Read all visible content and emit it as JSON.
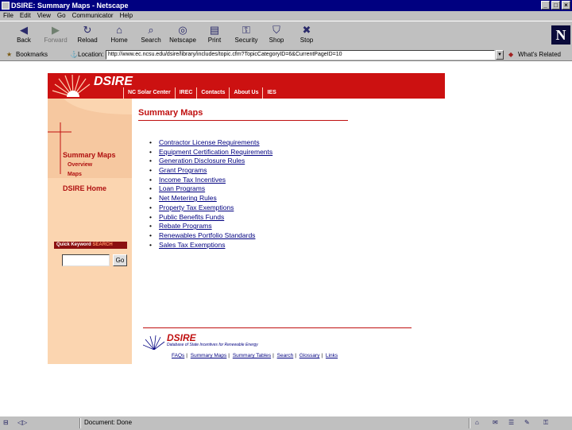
{
  "window": {
    "title": "DSIRE: Summary Maps - Netscape",
    "btn_min": "_",
    "btn_max": "□",
    "btn_close": "×"
  },
  "menus": [
    "File",
    "Edit",
    "View",
    "Go",
    "Communicator",
    "Help"
  ],
  "toolbar": {
    "buttons": [
      {
        "label": "Back",
        "icon": "back-arrow-icon",
        "glyph": "◀"
      },
      {
        "label": "Forward",
        "icon": "forward-arrow-icon",
        "glyph": "▶"
      },
      {
        "label": "Reload",
        "icon": "reload-icon",
        "glyph": "↻"
      },
      {
        "label": "Home",
        "icon": "home-icon",
        "glyph": "⌂"
      },
      {
        "label": "Search",
        "icon": "search-icon",
        "glyph": "⌕"
      },
      {
        "label": "Netscape",
        "icon": "netscape-icon",
        "glyph": "◎"
      },
      {
        "label": "Print",
        "icon": "print-icon",
        "glyph": "▤"
      },
      {
        "label": "Security",
        "icon": "lock-icon",
        "glyph": "⚿"
      },
      {
        "label": "Shop",
        "icon": "shop-icon",
        "glyph": "⛉"
      },
      {
        "label": "Stop",
        "icon": "stop-icon",
        "glyph": "✖"
      }
    ],
    "logo": "N"
  },
  "location": {
    "bookmarks": "Bookmarks",
    "location_label": "Location:",
    "url": "http://www.ec.ncsu.edu/dsire/library/includes/topic.cfm?TopicCategoryID=6&CurrentPageID=10",
    "related": "What's Related"
  },
  "site": {
    "brand": "DSIRE",
    "nav": [
      "NC Solar Center",
      "IREC",
      "Contacts",
      "About Us",
      "IES"
    ],
    "sidebar": {
      "summary_maps": "Summary Maps",
      "overview": "Overview",
      "maps": "Maps",
      "home": "DSIRE Home",
      "keyword_label": "Quick Keyword",
      "keyword_highlight": "SEARCH",
      "go": "Go"
    },
    "content": {
      "title": "Summary Maps",
      "items": [
        "Contractor License Requirements",
        "Equipment Certification Requirements",
        "Generation Disclosure Rules",
        "Grant Programs",
        "Income Tax Incentives",
        "Loan Programs",
        "Net Metering Rules",
        "Property Tax Exemptions",
        "Public Benefits Funds",
        "Rebate Programs",
        "Renewables Portfolio Standards",
        "Sales Tax Exemptions"
      ]
    },
    "footer": {
      "brand": "DSIRE",
      "tagline": "Database of State Incentives for Renewable Energy",
      "links": [
        "FAQs",
        "Summary Maps",
        "Summary Tables",
        "Search",
        "Glossary",
        "Links"
      ]
    }
  },
  "status": {
    "text": "Document: Done"
  }
}
